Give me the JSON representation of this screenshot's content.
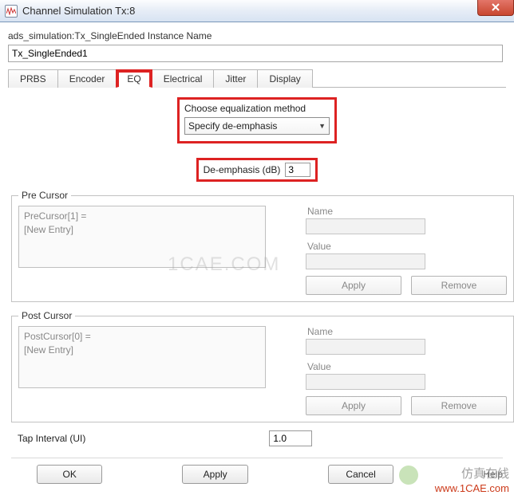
{
  "window": {
    "title": "Channel Simulation Tx:8"
  },
  "instance": {
    "label": "ads_simulation:Tx_SingleEnded Instance Name",
    "value": "Tx_SingleEnded1"
  },
  "tabs": [
    {
      "label": "PRBS",
      "active": false
    },
    {
      "label": "Encoder",
      "active": false
    },
    {
      "label": "EQ",
      "active": true
    },
    {
      "label": "Electrical",
      "active": false
    },
    {
      "label": "Jitter",
      "active": false
    },
    {
      "label": "Display",
      "active": false
    }
  ],
  "eq": {
    "choose_label": "Choose equalization method",
    "choose_value": "Specify de-emphasis",
    "de_label": "De-emphasis (dB)",
    "de_value": "3"
  },
  "precursor": {
    "legend": "Pre Cursor",
    "list": [
      "PreCursor[1] =",
      "[New Entry]"
    ],
    "name_label": "Name",
    "value_label": "Value",
    "apply": "Apply",
    "remove": "Remove"
  },
  "postcursor": {
    "legend": "Post Cursor",
    "list": [
      "PostCursor[0] =",
      "[New Entry]"
    ],
    "name_label": "Name",
    "value_label": "Value",
    "apply": "Apply",
    "remove": "Remove"
  },
  "tap": {
    "label": "Tap Interval (UI)",
    "value": "1.0"
  },
  "buttons": {
    "ok": "OK",
    "apply": "Apply",
    "cancel": "Cancel",
    "help": "Help"
  },
  "watermarks": {
    "w1": "1CAE.COM",
    "w2": "仿真在线",
    "w3": "www.1CAE.com"
  }
}
